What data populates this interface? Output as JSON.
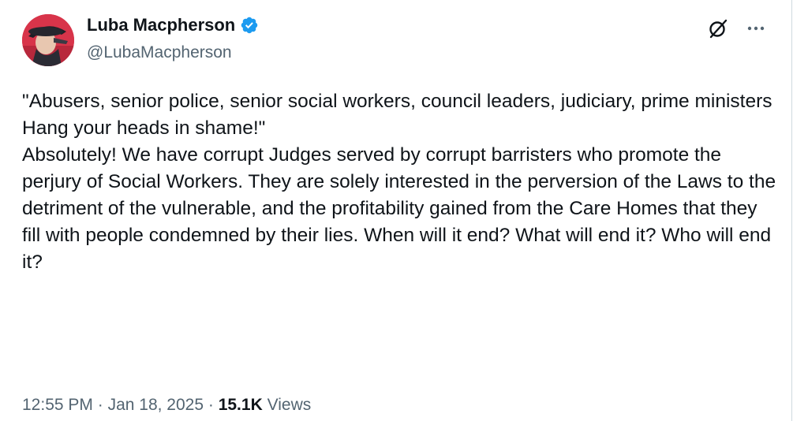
{
  "tweet": {
    "author": {
      "display_name": "Luba Macpherson",
      "handle": "@LubaMacpherson",
      "verified": true,
      "verified_color": "#1d9bf0"
    },
    "text_lines": [
      "\"Abusers, senior police, senior social workers, council leaders, judiciary, prime ministers",
      "Hang your heads in shame!\"",
      "Absolutely! We have corrupt Judges served by corrupt barristers who promote the perjury of Social Workers. They are solely interested in the perversion of the Laws to the detriment of the vulnerable, and the profitability gained from the Care Homes that they fill with people condemned by their lies. When will it end? What will end it? Who will end it?"
    ],
    "time": "12:55 PM",
    "date": "Jan 18, 2025",
    "separator": "·",
    "views_count": "15.1K",
    "views_label": "Views",
    "icons": {
      "grok": "grok-icon",
      "more": "more-horizontal-icon"
    }
  }
}
